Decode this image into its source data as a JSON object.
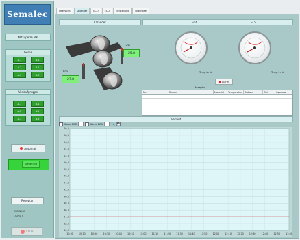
{
  "sidebar": {
    "logo": "Semalec",
    "company": "Mitsuperm PHI",
    "groups": [
      {
        "title": "Gerne",
        "buttons": [
          "A.1",
          "B.1",
          "A.2",
          "B.2",
          "A.3",
          "B.3"
        ]
      },
      {
        "title": "Vorlaufgruppe",
        "buttons": [
          "A.1",
          "B.1",
          "A.2",
          "B.2",
          "A.3",
          "B.3"
        ]
      }
    ],
    "auto_label": "Automat",
    "ok_label": "Steuerung",
    "rezept_label": "Rezeptur",
    "status_lines": [
      "RUNNING",
      "OK/RUT"
    ],
    "stop_label": "STOP"
  },
  "tabs": [
    "Ubersicht",
    "Kalander",
    "ECO",
    "ECO",
    "Einstellung",
    "Diagnose"
  ],
  "kalander": {
    "header": "Kalander",
    "top_value": "25.8",
    "top_label": "Grei",
    "left_value": "27.8",
    "left_label": "ECB"
  },
  "gauges": [
    {
      "header": "ECA",
      "label": "Temp in %"
    },
    {
      "header": "ECS",
      "label": "Temp in %"
    }
  ],
  "stop_small": "Alarm",
  "table": {
    "title": "Rezeptur",
    "columns": [
      "Nr.",
      "Rezept",
      "Material",
      "Temperatur",
      "Datum",
      "Zeit",
      "Operator"
    ]
  },
  "chart_panel_header": "Verlauf",
  "chart_toolbar": {
    "cb1": "Kanal ECB",
    "cb2": "Kanal ECB"
  },
  "chart_data": {
    "type": "line",
    "yticks": [
      "60,0",
      "58,0",
      "56,0",
      "54,0",
      "52,0",
      "50,0",
      "48,0",
      "46,0",
      "44,0",
      "42,0",
      "40,0",
      "38,0",
      "36,0",
      "34,0",
      "32,0",
      "30,0"
    ],
    "xticks": [
      "10:00",
      "10:10",
      "10:20",
      "10:30",
      "10:40",
      "10:50",
      "11:00",
      "11:10",
      "11:20",
      "11:30",
      "11:40",
      "11:50",
      "12:00",
      "12:10",
      "12:20",
      "12:30",
      "12:40",
      "12:50",
      "13:00"
    ],
    "series": [
      {
        "values": [
          34,
          34,
          34,
          34,
          34,
          34,
          34,
          34,
          34,
          34,
          34,
          34,
          34,
          34,
          34,
          34,
          34,
          34,
          34
        ]
      }
    ],
    "ylim": [
      30,
      60
    ],
    "grid": true,
    "colors": {
      "background": "#dff6f8",
      "line": "#c94a4a"
    }
  }
}
